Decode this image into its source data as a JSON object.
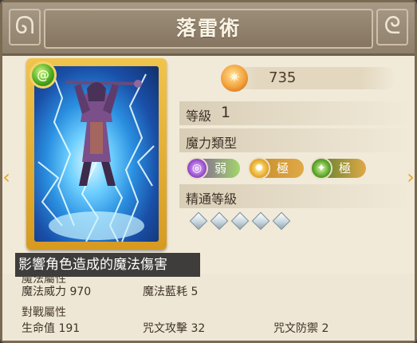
{
  "header": {
    "title": "落雷術",
    "left_ornament": "ᘏ",
    "right_ornament": "ᘓ"
  },
  "nav": {
    "prev_arrow": "‹",
    "next_arrow": "›"
  },
  "card": {
    "element_icon": "spiral-green-icon",
    "element_glyph": "@"
  },
  "cost": {
    "icon": "flame-book-icon",
    "value": "735"
  },
  "level": {
    "label": "等級",
    "value": "1"
  },
  "magic_type": {
    "label": "魔力類型",
    "types": [
      {
        "icon": "dark-orb-icon",
        "glyph": "◎",
        "text": "弱"
      },
      {
        "icon": "sun-icon",
        "glyph": "✹",
        "text": "極"
      },
      {
        "icon": "nature-star-icon",
        "glyph": "✦",
        "text": "極"
      }
    ]
  },
  "mastery": {
    "label": "精通等級",
    "gem_count": 5
  },
  "tooltip": {
    "text": "影響角色造成的魔法傷害"
  },
  "magic_attributes": {
    "title": "魔法屬性",
    "power_label": "魔法威力 970",
    "mana_label": "魔法藍耗 5"
  },
  "combat_attributes": {
    "title": "對戰屬性",
    "hp": "生命值 191",
    "spell_attack": "咒文攻擊 32",
    "spell_defense": "咒文防禦 2"
  },
  "colors": {
    "accent_gold": "#e2a72a",
    "panel_bg": "#f1ead9",
    "header_bg": "#8e7f6b"
  }
}
